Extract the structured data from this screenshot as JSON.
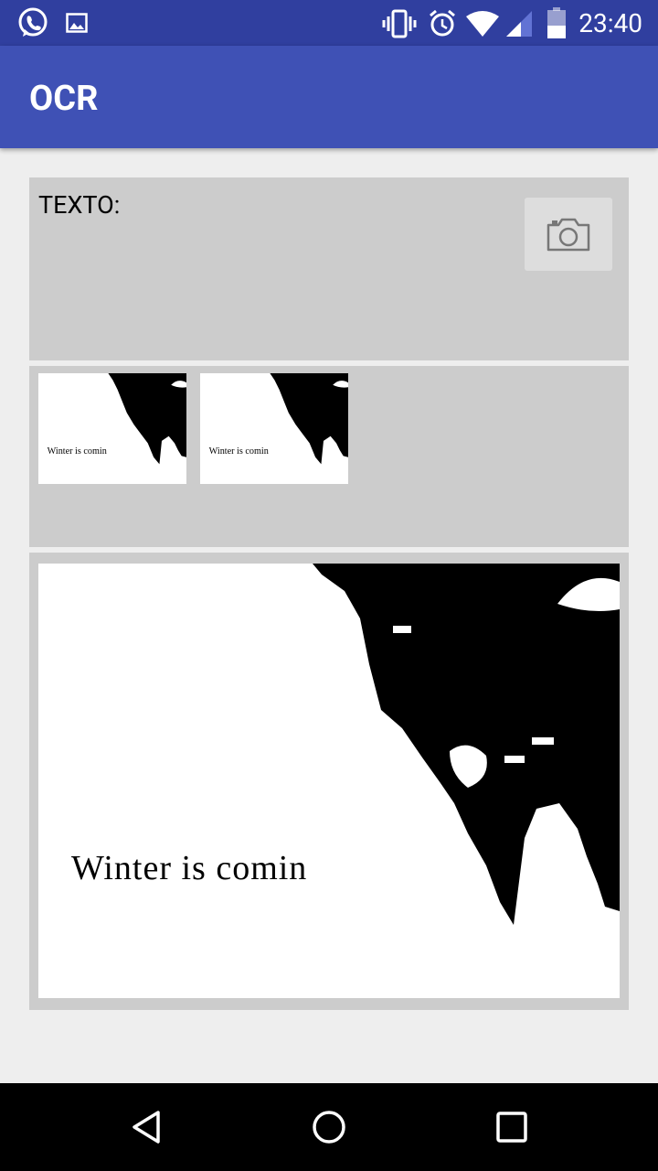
{
  "status_bar": {
    "time": "23:40",
    "icons": [
      "whatsapp-icon",
      "gallery-icon",
      "vibrate-icon",
      "alarm-icon",
      "wifi-icon",
      "signal-icon",
      "battery-icon"
    ]
  },
  "app_bar": {
    "title": "OCR"
  },
  "text_panel": {
    "label": "TEXTO:",
    "camera_icon": "camera-icon"
  },
  "image_caption": "Winter is comin",
  "nav_bar": {
    "icons": [
      "back-icon",
      "home-icon",
      "recents-icon"
    ]
  },
  "colors": {
    "status_bar": "#303f9f",
    "app_bar": "#3f51b5",
    "background": "#eeeeee",
    "panel": "#cccccc"
  }
}
